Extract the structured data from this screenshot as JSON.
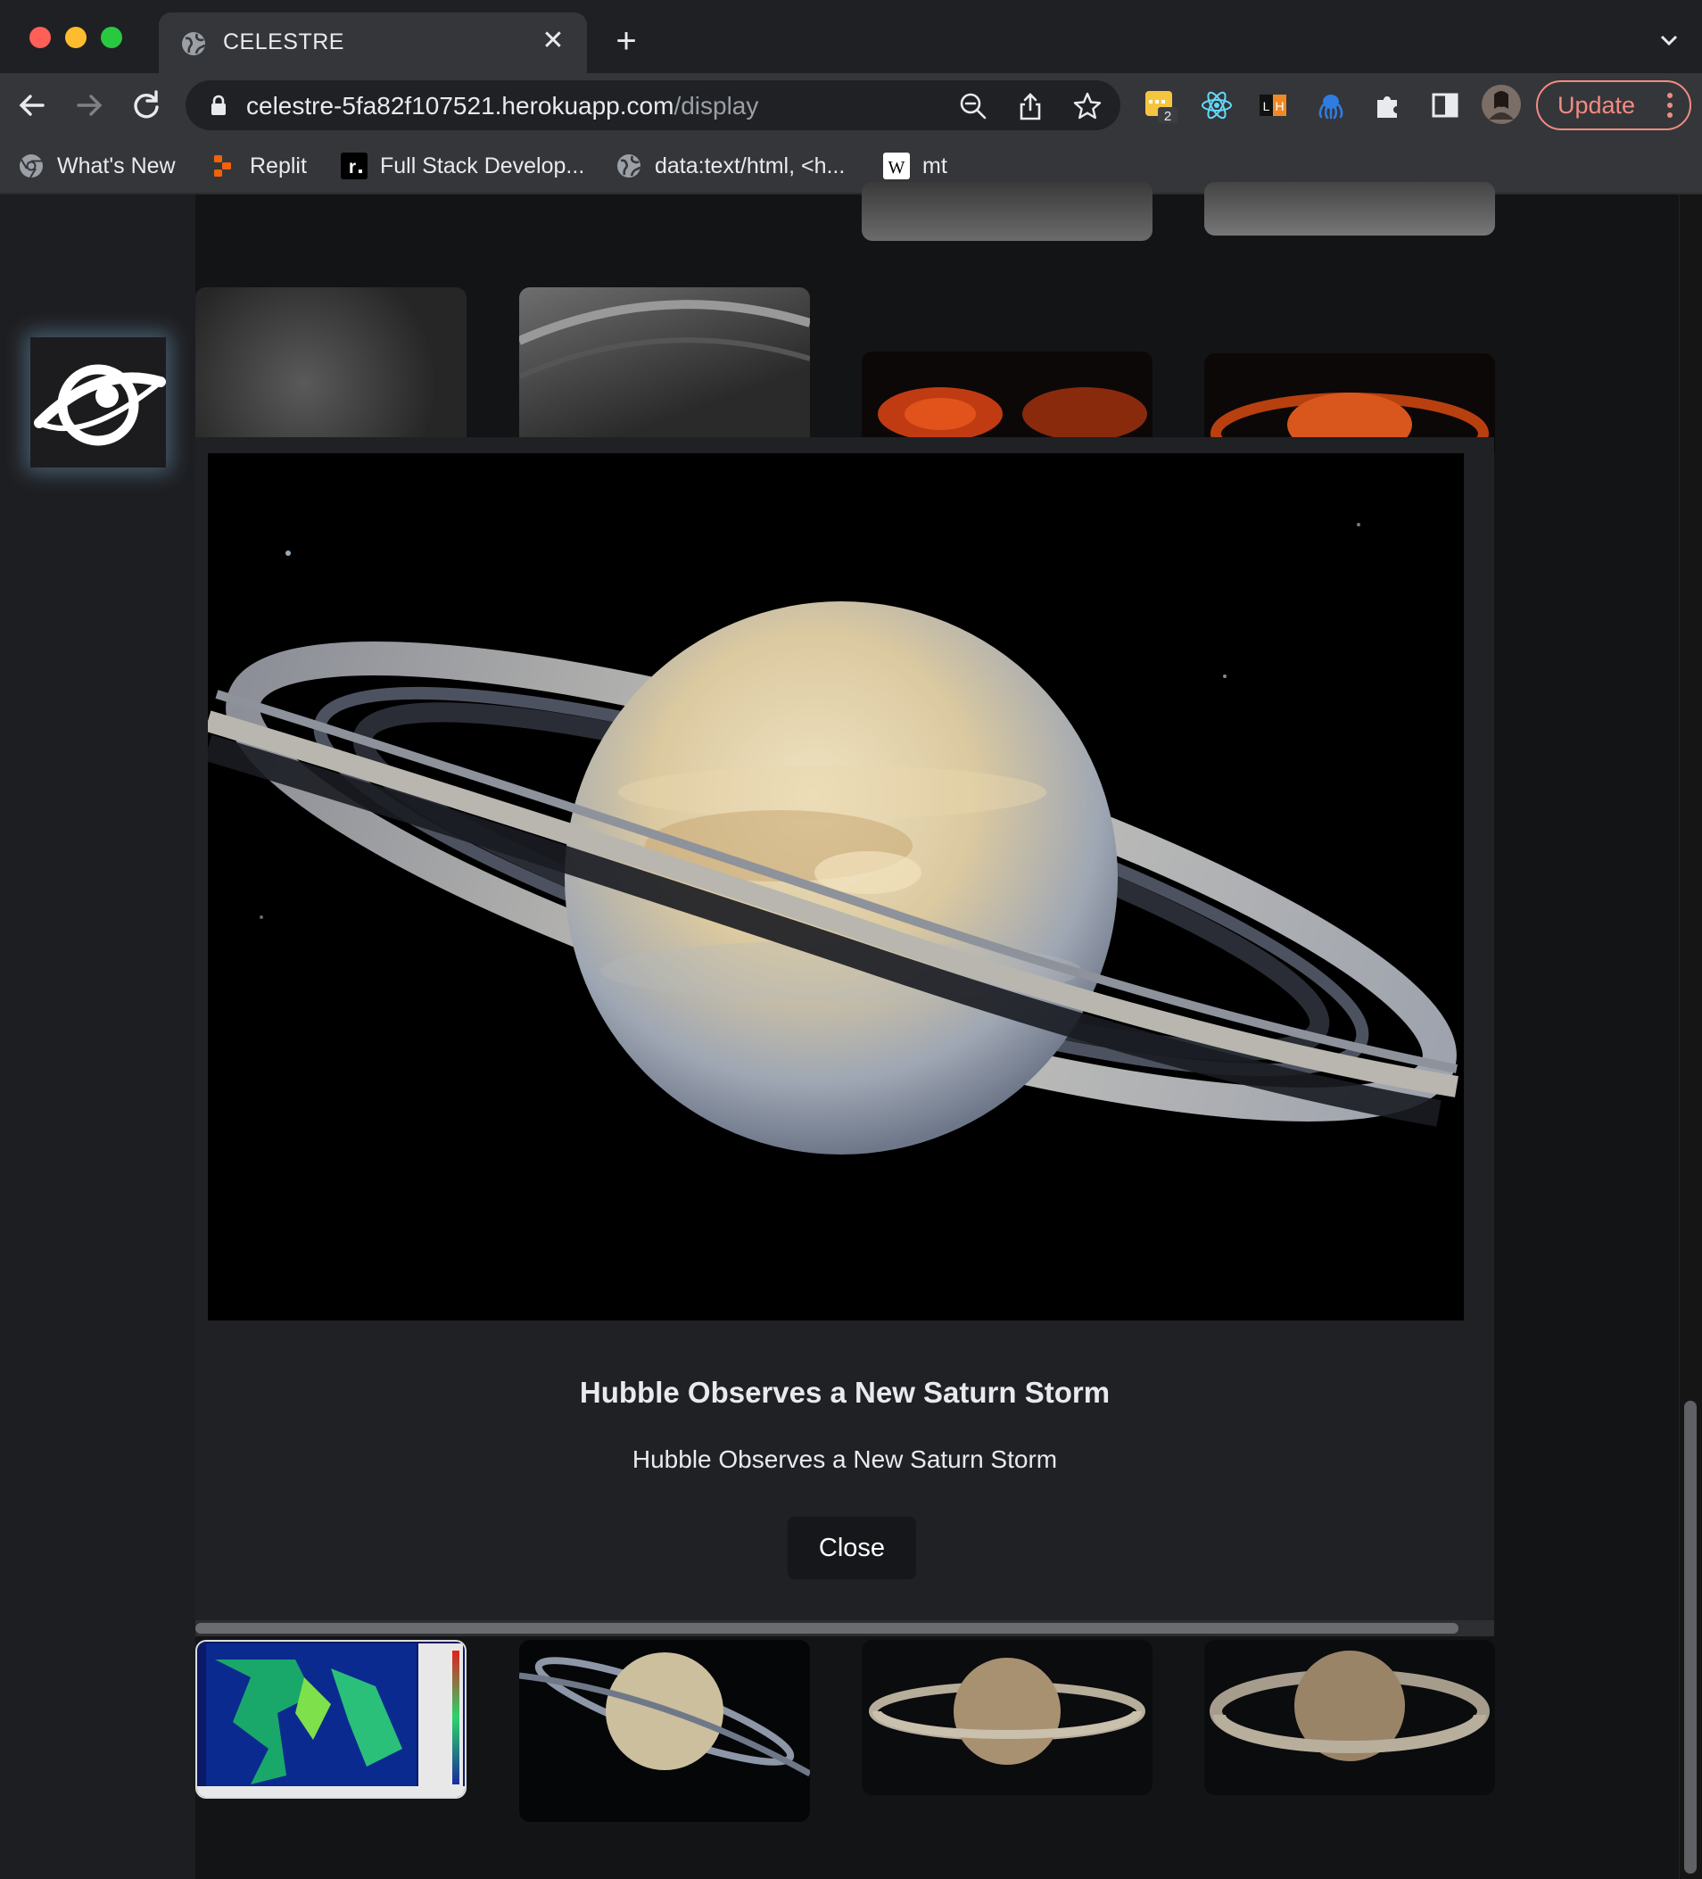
{
  "browser": {
    "tab_title": "CELESTRE",
    "url_host": "celestre-5fa82f107521.herokuapp.com",
    "url_path": "/display",
    "update_label": "Update",
    "extension_badge": "2",
    "bookmarks": [
      {
        "label": "What's New",
        "icon": "chrome-icon"
      },
      {
        "label": "Replit",
        "icon": "replit-icon"
      },
      {
        "label": "Full Stack Develop...",
        "icon": "r-dot-icon"
      },
      {
        "label": "data:text/html, <h...",
        "icon": "globe-icon"
      },
      {
        "label": "mt",
        "icon": "wikipedia-icon"
      }
    ]
  },
  "modal": {
    "title": "Hubble Observes a New Saturn Storm",
    "description": "Hubble Observes a New Saturn Storm",
    "close_label": "Close"
  },
  "colors": {
    "accent_update": "#f28b82",
    "page_bg": "#131416",
    "modal_bg": "#202124",
    "logo_glow": "#96d2ff"
  }
}
